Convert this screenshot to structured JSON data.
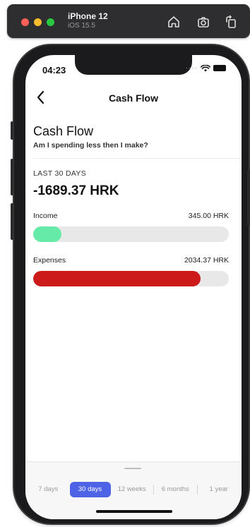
{
  "simulator": {
    "device_name": "iPhone 12",
    "os_version": "iOS 15.5",
    "icons": [
      "home-icon",
      "screenshot-icon",
      "rotate-icon"
    ]
  },
  "status_bar": {
    "time": "04:23",
    "icons": [
      "signal-dots-icon",
      "wifi-icon",
      "battery-icon"
    ]
  },
  "nav": {
    "title": "Cash Flow",
    "back_icon": "chevron-left-icon"
  },
  "header": {
    "title": "Cash Flow",
    "subtitle": "Am I spending less then I make?"
  },
  "summary": {
    "period_label": "LAST 30 DAYS",
    "total": "-1689.37 HRK"
  },
  "rows": [
    {
      "label": "Income",
      "value": "345.00 HRK",
      "fill_fraction": 0.145,
      "color": "#66eaa8"
    },
    {
      "label": "Expenses",
      "value": "2034.37 HRK",
      "fill_fraction": 0.855,
      "color": "#cc1a1a"
    }
  ],
  "periods": {
    "options": [
      "7 days",
      "30 days",
      "12 weeks",
      "6 months",
      "1 year"
    ],
    "selected": "30 days"
  },
  "colors": {
    "accent": "#4e63e6",
    "income": "#66eaa8",
    "expenses": "#cc1a1a",
    "track": "#e8e8e8"
  }
}
